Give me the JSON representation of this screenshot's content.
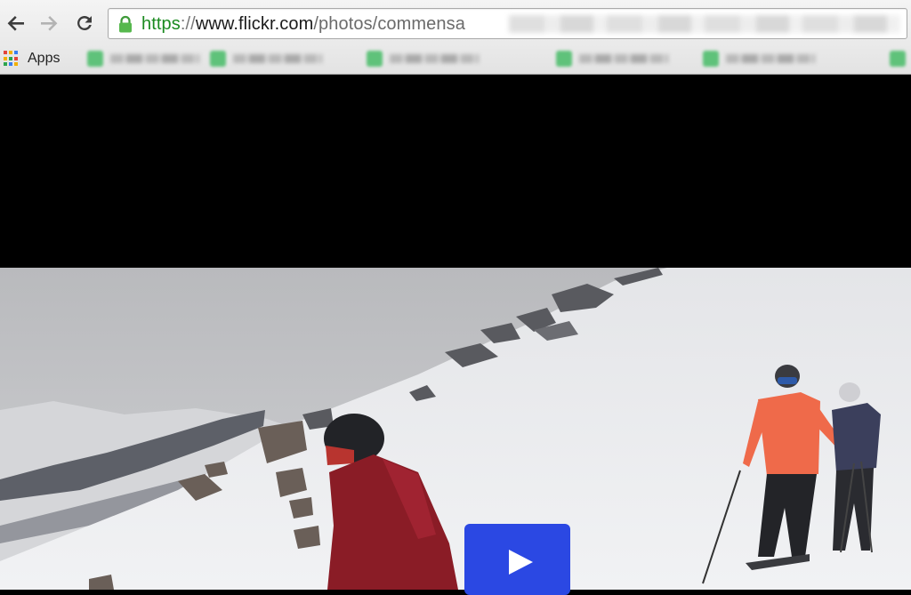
{
  "browser": {
    "url": {
      "scheme": "https",
      "separator": "://",
      "host": "www.flickr.com",
      "path": "/photos/commensa"
    },
    "bookmarks_bar": {
      "apps_label": "Apps"
    },
    "icons": {
      "back": "back-arrow-icon",
      "forward": "forward-arrow-icon",
      "reload": "reload-icon",
      "secure": "lock-icon",
      "apps": "apps-grid-icon",
      "play": "play-icon"
    }
  },
  "colors": {
    "secure_scheme": "#1a8a1f",
    "play_button": "#2b48e3",
    "bookmark_favicon": "#5fc27a"
  }
}
